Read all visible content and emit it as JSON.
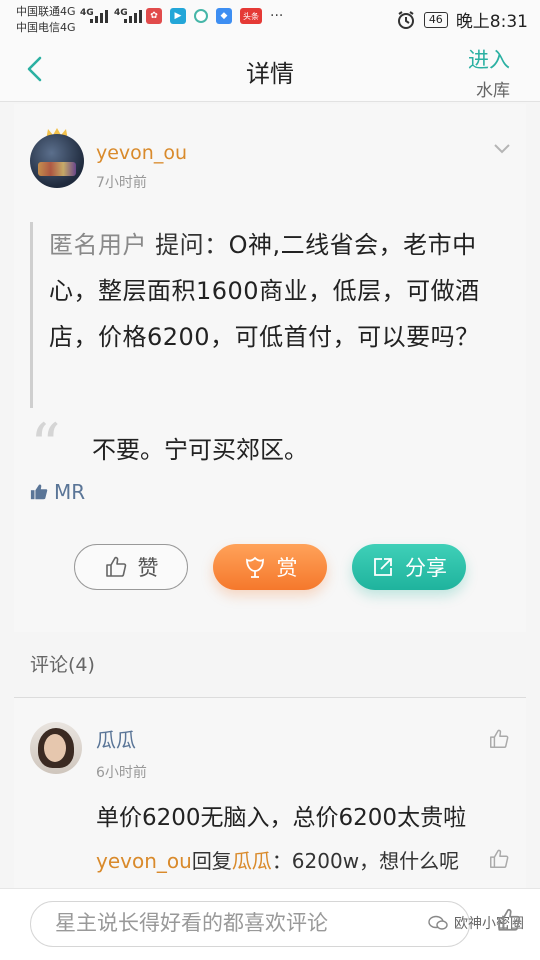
{
  "status": {
    "carrier_1": "中国联通4G",
    "carrier_2": "中国电信4G",
    "signal_1": "4G",
    "signal_2": "4G",
    "battery": "46",
    "time": "晚上8:31",
    "app_icons": [
      "weibo-icon",
      "bilibili-icon",
      "refresh-icon",
      "browser-icon",
      "toutiao-icon"
    ],
    "toutiao_label": "头条",
    "more": "···"
  },
  "header": {
    "title": "详情",
    "enter_label": "进入",
    "reservoir_label": "水库"
  },
  "post": {
    "username": "yevon_ou",
    "time": "7小时前",
    "question_user": "匿名用户",
    "question_label": "提问：",
    "question_text": "O神,二线省会，老市中心，整层面积1600商业，低层，可做酒店，价格6200，可低首付，可以要吗？",
    "answer": "不要。宁可买郊区。",
    "liked_by": "MR"
  },
  "actions": {
    "like_label": "赞",
    "reward_label": "赏",
    "share_label": "分享"
  },
  "comments": {
    "header": "评论(4)",
    "items": [
      {
        "name": "瓜瓜",
        "time": "6小时前",
        "text": "单价6200无脑入，总价6200太贵啦",
        "reply_from": "yevon_ou",
        "reply_word": "回复",
        "reply_to": "瓜瓜",
        "reply_text": "：6200w，想什么呢"
      }
    ]
  },
  "bottom": {
    "comment_placeholder": "星主说长得好看的都喜欢评论",
    "watermark": "欧神小密圈"
  },
  "colors": {
    "accent_teal": "#2bb0a2",
    "orange": "#f5782c",
    "username_orange": "#d98a2b",
    "link_blue": "#5a7597"
  }
}
